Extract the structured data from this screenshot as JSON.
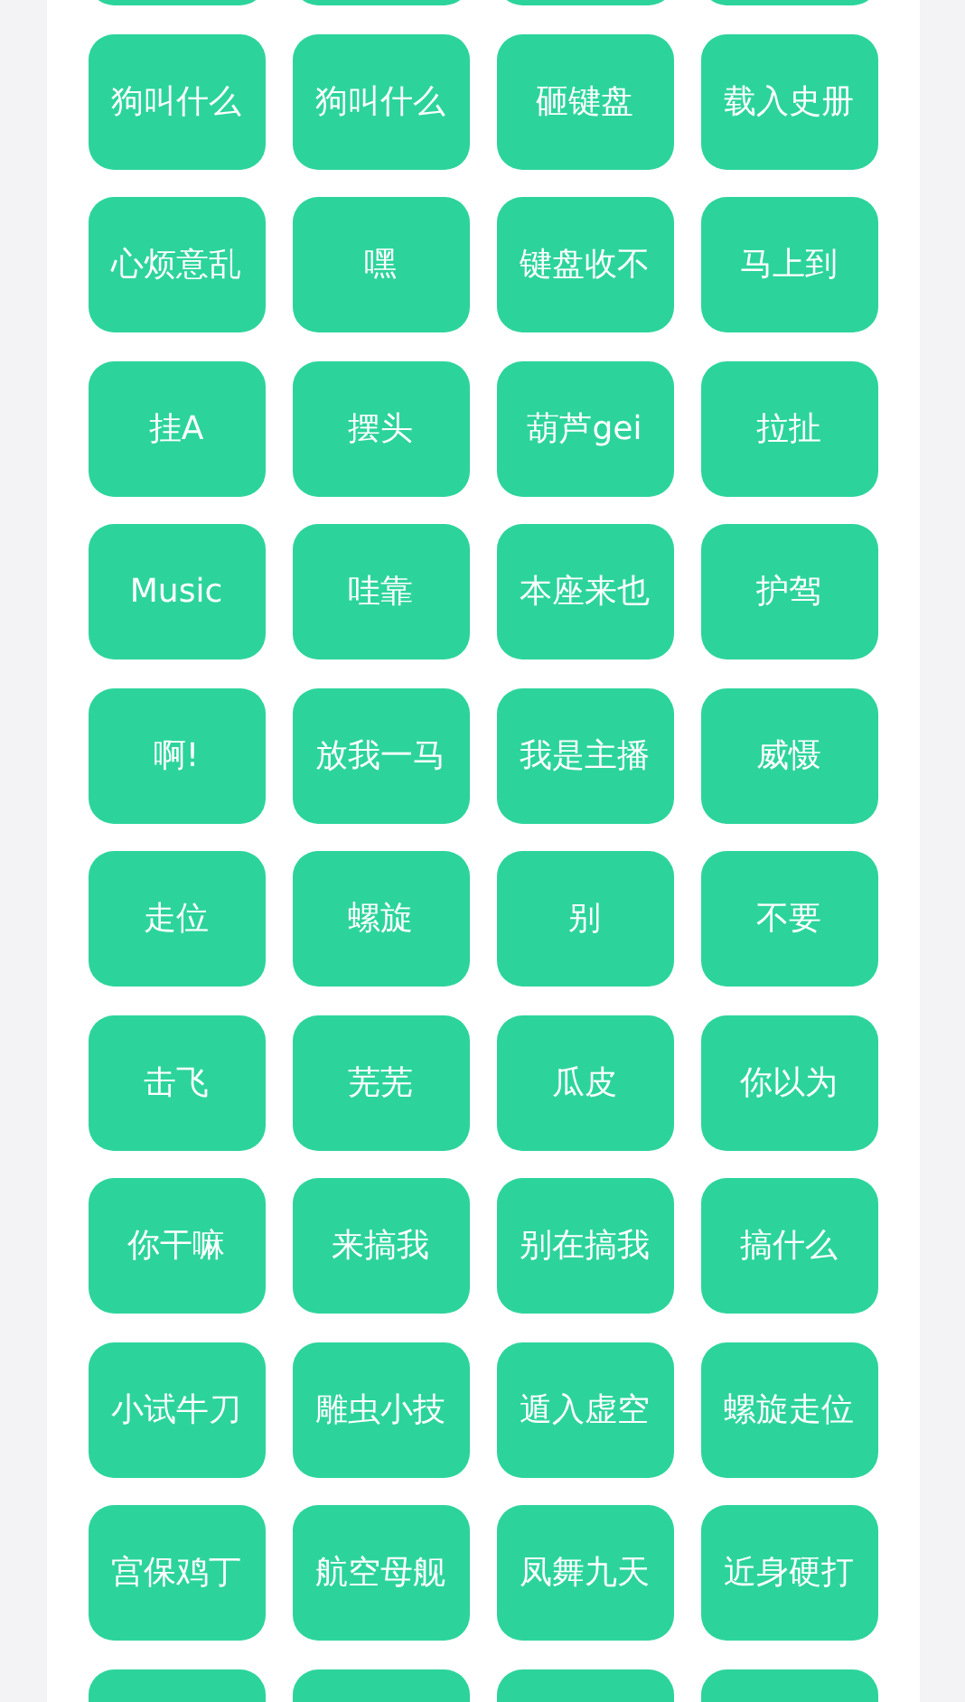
{
  "buttons": [
    {
      "label": "狗叫什么"
    },
    {
      "label": "狗叫什么"
    },
    {
      "label": "砸键盘"
    },
    {
      "label": "载入史册"
    },
    {
      "label": "心烦意乱"
    },
    {
      "label": "嘿"
    },
    {
      "label": "键盘收不"
    },
    {
      "label": "马上到"
    },
    {
      "label": "挂A"
    },
    {
      "label": "摆头"
    },
    {
      "label": "葫芦gei"
    },
    {
      "label": "拉扯"
    },
    {
      "label": "Music"
    },
    {
      "label": "哇靠"
    },
    {
      "label": "本座来也"
    },
    {
      "label": "护驾"
    },
    {
      "label": "啊!"
    },
    {
      "label": "放我一马"
    },
    {
      "label": "我是主播"
    },
    {
      "label": "威慑"
    },
    {
      "label": "走位"
    },
    {
      "label": "螺旋"
    },
    {
      "label": "别"
    },
    {
      "label": "不要"
    },
    {
      "label": "击飞"
    },
    {
      "label": "芜芜"
    },
    {
      "label": "瓜皮"
    },
    {
      "label": "你以为"
    },
    {
      "label": "你干嘛"
    },
    {
      "label": "来搞我"
    },
    {
      "label": "别在搞我"
    },
    {
      "label": "搞什么"
    },
    {
      "label": "小试牛刀"
    },
    {
      "label": "雕虫小技"
    },
    {
      "label": "遁入虚空"
    },
    {
      "label": "螺旋走位"
    },
    {
      "label": "宫保鸡丁"
    },
    {
      "label": "航空母舰"
    },
    {
      "label": "凤舞九天"
    },
    {
      "label": "近身硬打"
    }
  ]
}
